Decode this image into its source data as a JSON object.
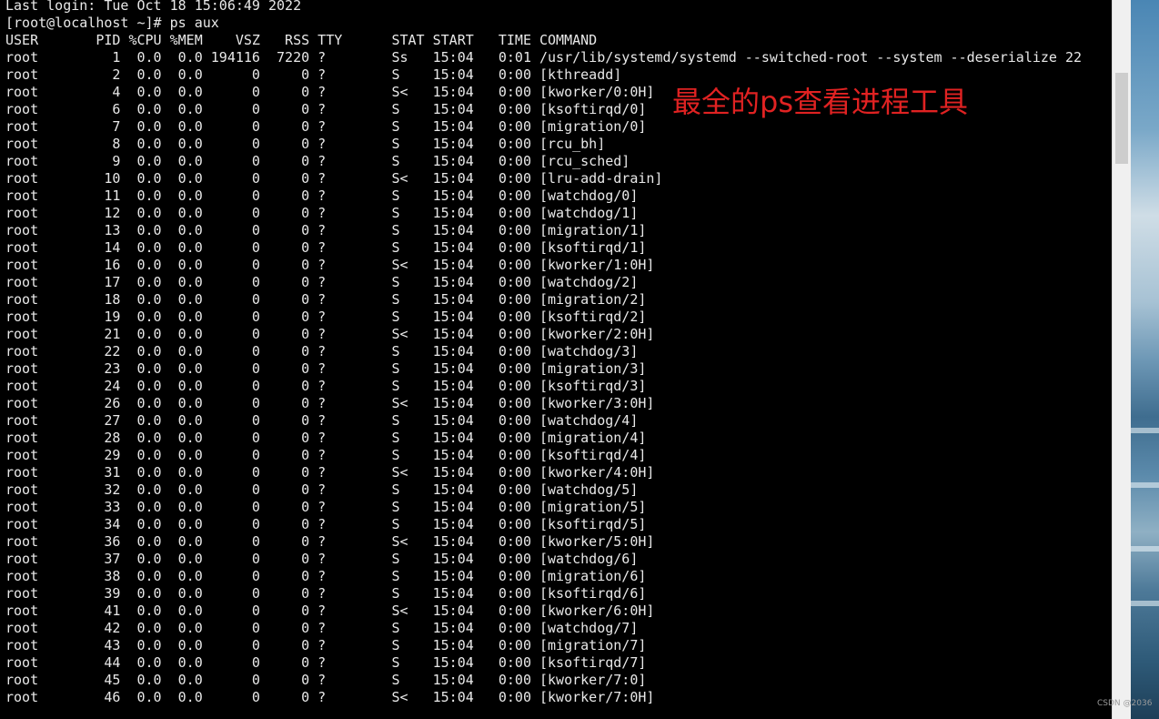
{
  "terminal": {
    "lines": [
      "Last login: Tue Oct 18 15:06:49 2022",
      "[root@localhost ~]# ps aux",
      "USER       PID %CPU %MEM    VSZ   RSS TTY      STAT START   TIME COMMAND",
      "root         1  0.0  0.0 194116  7220 ?        Ss   15:04   0:01 /usr/lib/systemd/systemd --switched-root --system --deserialize 22",
      "root         2  0.0  0.0      0     0 ?        S    15:04   0:00 [kthreadd]",
      "root         4  0.0  0.0      0     0 ?        S<   15:04   0:00 [kworker/0:0H]",
      "root         6  0.0  0.0      0     0 ?        S    15:04   0:00 [ksoftirqd/0]",
      "root         7  0.0  0.0      0     0 ?        S    15:04   0:00 [migration/0]",
      "root         8  0.0  0.0      0     0 ?        S    15:04   0:00 [rcu_bh]",
      "root         9  0.0  0.0      0     0 ?        S    15:04   0:00 [rcu_sched]",
      "root        10  0.0  0.0      0     0 ?        S<   15:04   0:00 [lru-add-drain]",
      "root        11  0.0  0.0      0     0 ?        S    15:04   0:00 [watchdog/0]",
      "root        12  0.0  0.0      0     0 ?        S    15:04   0:00 [watchdog/1]",
      "root        13  0.0  0.0      0     0 ?        S    15:04   0:00 [migration/1]",
      "root        14  0.0  0.0      0     0 ?        S    15:04   0:00 [ksoftirqd/1]",
      "root        16  0.0  0.0      0     0 ?        S<   15:04   0:00 [kworker/1:0H]",
      "root        17  0.0  0.0      0     0 ?        S    15:04   0:00 [watchdog/2]",
      "root        18  0.0  0.0      0     0 ?        S    15:04   0:00 [migration/2]",
      "root        19  0.0  0.0      0     0 ?        S    15:04   0:00 [ksoftirqd/2]",
      "root        21  0.0  0.0      0     0 ?        S<   15:04   0:00 [kworker/2:0H]",
      "root        22  0.0  0.0      0     0 ?        S    15:04   0:00 [watchdog/3]",
      "root        23  0.0  0.0      0     0 ?        S    15:04   0:00 [migration/3]",
      "root        24  0.0  0.0      0     0 ?        S    15:04   0:00 [ksoftirqd/3]",
      "root        26  0.0  0.0      0     0 ?        S<   15:04   0:00 [kworker/3:0H]",
      "root        27  0.0  0.0      0     0 ?        S    15:04   0:00 [watchdog/4]",
      "root        28  0.0  0.0      0     0 ?        S    15:04   0:00 [migration/4]",
      "root        29  0.0  0.0      0     0 ?        S    15:04   0:00 [ksoftirqd/4]",
      "root        31  0.0  0.0      0     0 ?        S<   15:04   0:00 [kworker/4:0H]",
      "root        32  0.0  0.0      0     0 ?        S    15:04   0:00 [watchdog/5]",
      "root        33  0.0  0.0      0     0 ?        S    15:04   0:00 [migration/5]",
      "root        34  0.0  0.0      0     0 ?        S    15:04   0:00 [ksoftirqd/5]",
      "root        36  0.0  0.0      0     0 ?        S<   15:04   0:00 [kworker/5:0H]",
      "root        37  0.0  0.0      0     0 ?        S    15:04   0:00 [watchdog/6]",
      "root        38  0.0  0.0      0     0 ?        S    15:04   0:00 [migration/6]",
      "root        39  0.0  0.0      0     0 ?        S    15:04   0:00 [ksoftirqd/6]",
      "root        41  0.0  0.0      0     0 ?        S<   15:04   0:00 [kworker/6:0H]",
      "root        42  0.0  0.0      0     0 ?        S    15:04   0:00 [watchdog/7]",
      "root        43  0.0  0.0      0     0 ?        S    15:04   0:00 [migration/7]",
      "root        44  0.0  0.0      0     0 ?        S    15:04   0:00 [ksoftirqd/7]",
      "root        45  0.0  0.0      0     0 ?        S    15:04   0:00 [kworker/7:0]",
      "root        46  0.0  0.0      0     0 ?        S<   15:04   0:00 [kworker/7:0H]"
    ]
  },
  "annotation": {
    "text": "最全的ps查看进程工具",
    "color": "#e02222"
  },
  "watermark": {
    "text": "CSDN @2036"
  },
  "colors": {
    "terminal_background": "#000000",
    "terminal_text": "#e8e8e8"
  }
}
